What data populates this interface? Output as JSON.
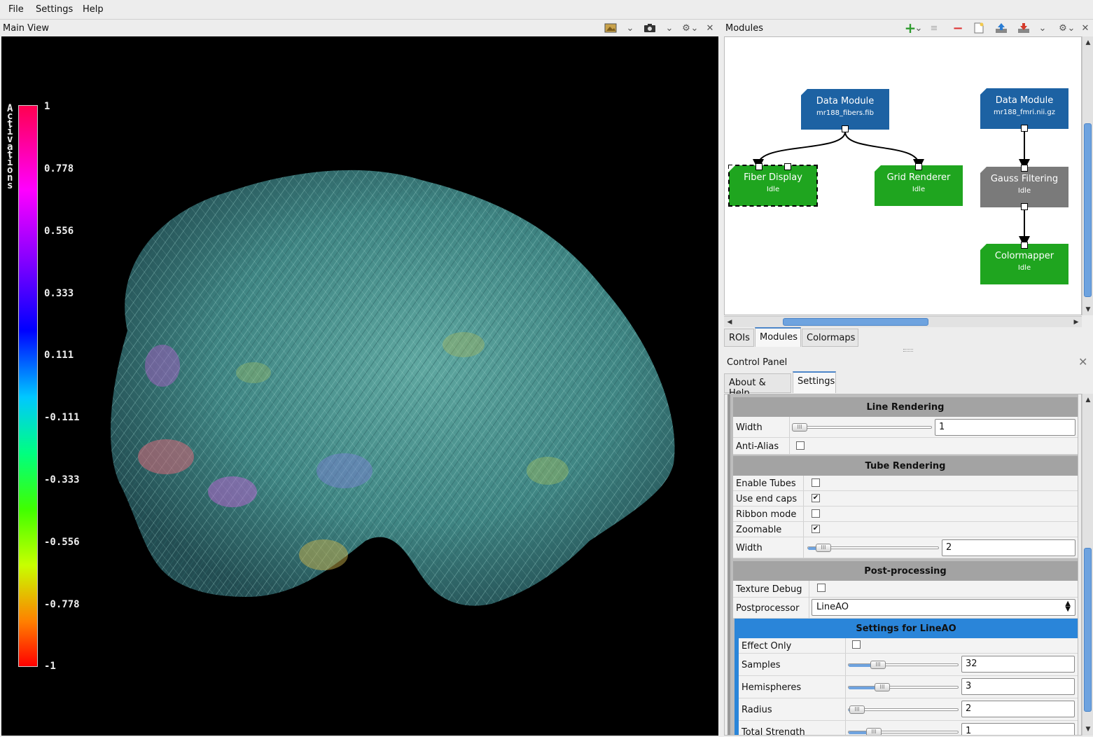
{
  "menubar": {
    "items": [
      "File",
      "Settings",
      "Help"
    ]
  },
  "main_view": {
    "title": "Main View",
    "colorbar": {
      "title": "Activations",
      "labels": [
        "1",
        "0.778",
        "0.556",
        "0.333",
        "0.111",
        "-0.111",
        "-0.333",
        "-0.556",
        "-0.778",
        "-1"
      ]
    }
  },
  "modules_panel": {
    "title": "Modules",
    "nodes": [
      {
        "title": "Data Module",
        "subtitle": "mr188_fibers.fib",
        "color": "#1d62a3"
      },
      {
        "title": "Data Module",
        "subtitle": "mr188_fmri.nii.gz",
        "color": "#1d62a3"
      },
      {
        "title": "Fiber Display",
        "subtitle": "Idle",
        "color": "#1fa51f"
      },
      {
        "title": "Grid Renderer",
        "subtitle": "Idle",
        "color": "#1fa51f"
      },
      {
        "title": "Gauss Filtering",
        "subtitle": "Idle",
        "color": "#7a7a7a"
      },
      {
        "title": "Colormapper",
        "subtitle": "Idle",
        "color": "#1fa51f"
      }
    ],
    "tabs": [
      "ROIs",
      "Modules",
      "Colormaps"
    ]
  },
  "control_panel": {
    "title": "Control Panel",
    "tabs": [
      "About & Help",
      "Settings"
    ],
    "line_rendering": {
      "header": "Line Rendering",
      "width_label": "Width",
      "width_value": "1",
      "width_level": 0.02,
      "antialias_label": "Anti-Alias",
      "antialias_checked": false
    },
    "tube_rendering": {
      "header": "Tube Rendering",
      "enable_tubes_label": "Enable Tubes",
      "enable_tubes_checked": false,
      "end_caps_label": "Use end caps",
      "end_caps_checked": true,
      "ribbon_label": "Ribbon mode",
      "ribbon_checked": false,
      "zoomable_label": "Zoomable",
      "zoomable_checked": true,
      "width_label": "Width",
      "width_value": "2",
      "width_level": 0.08
    },
    "post_processing": {
      "header": "Post-processing",
      "texture_debug_label": "Texture Debug",
      "texture_debug_checked": false,
      "postprocessor_label": "Postprocessor",
      "postprocessor_value": "LineAO"
    },
    "lineao": {
      "header": "Settings for LineAO",
      "effect_only_label": "Effect Only",
      "effect_only_checked": false,
      "samples_label": "Samples",
      "samples_value": "32",
      "samples_level": 0.22,
      "hemispheres_label": "Hemispheres",
      "hemispheres_value": "3",
      "hemispheres_level": 0.26,
      "radius_label": "Radius",
      "radius_value": "2",
      "radius_level": 0.04,
      "strength_label": "Total Strength",
      "strength_value": "1",
      "strength_level": 0.19
    }
  }
}
